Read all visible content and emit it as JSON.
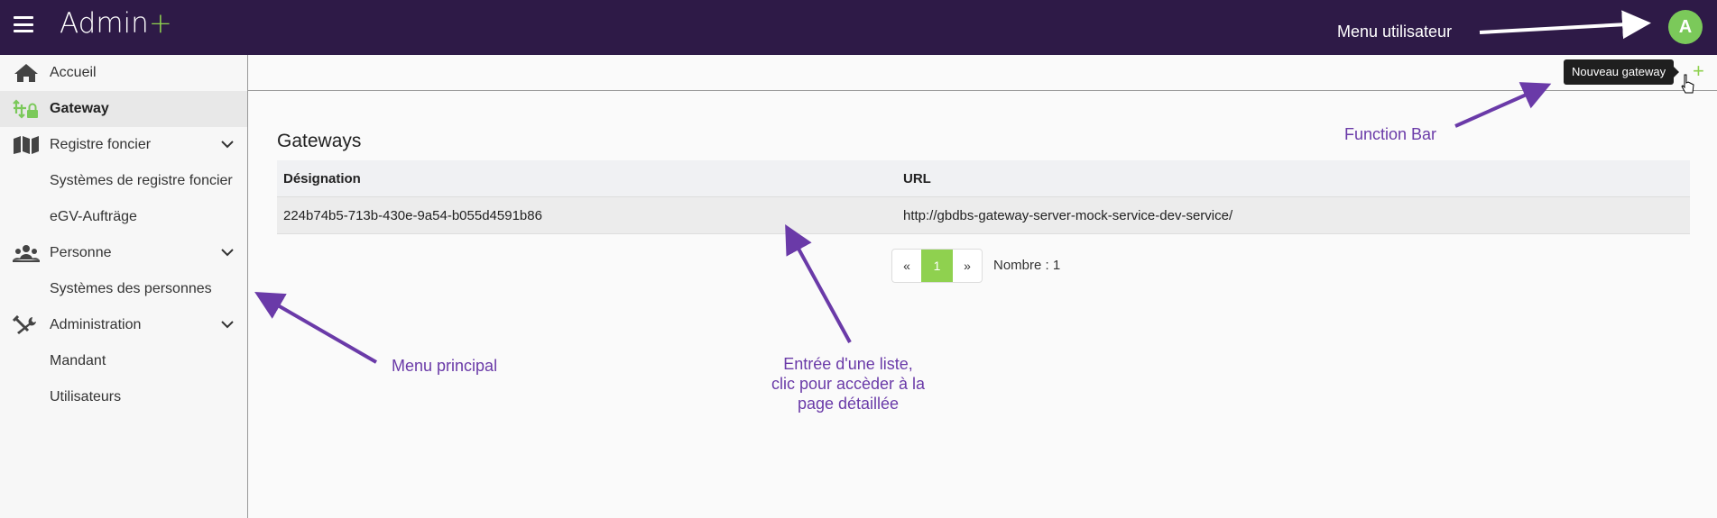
{
  "app": {
    "brand": "Admin",
    "brand_plus": "+",
    "avatar_initial": "A"
  },
  "sidebar": {
    "items": [
      {
        "label": "Accueil",
        "icon": "home-icon"
      },
      {
        "label": "Gateway",
        "icon": "gateway-icon",
        "active": true
      },
      {
        "label": "Registre foncier",
        "icon": "map-icon",
        "expandable": true
      },
      {
        "label": "Systèmes de registre foncier"
      },
      {
        "label": "eGV-Aufträge"
      },
      {
        "label": "Personne",
        "icon": "people-icon",
        "expandable": true
      },
      {
        "label": "Systèmes des personnes"
      },
      {
        "label": "Administration",
        "icon": "tools-icon",
        "expandable": true
      },
      {
        "label": "Mandant"
      },
      {
        "label": "Utilisateurs"
      }
    ]
  },
  "function_bar": {
    "tooltip": "Nouveau gateway",
    "add_label": "+"
  },
  "main": {
    "title": "Gateways",
    "table": {
      "headers": [
        "Désignation",
        "URL"
      ],
      "rows": [
        [
          "224b74b5-713b-430e-9a54-b055d4591b86",
          "http://gbdbs-gateway-server-mock-service-dev-service/"
        ]
      ]
    },
    "pagination": {
      "prev": "«",
      "current": "1",
      "next": "»",
      "count": "Nombre : 1"
    }
  },
  "annotations": {
    "user_menu": "Menu utilisateur",
    "function_bar": "Function Bar",
    "main_menu": "Menu principal",
    "list_entry_1": "Entrée d'une liste,",
    "list_entry_2": "clic pour accèder à la",
    "list_entry_3": "page détaillée"
  },
  "colors": {
    "topbar": "#2e1a47",
    "accent": "#8fd14f",
    "annotation": "#6a3aa8"
  }
}
